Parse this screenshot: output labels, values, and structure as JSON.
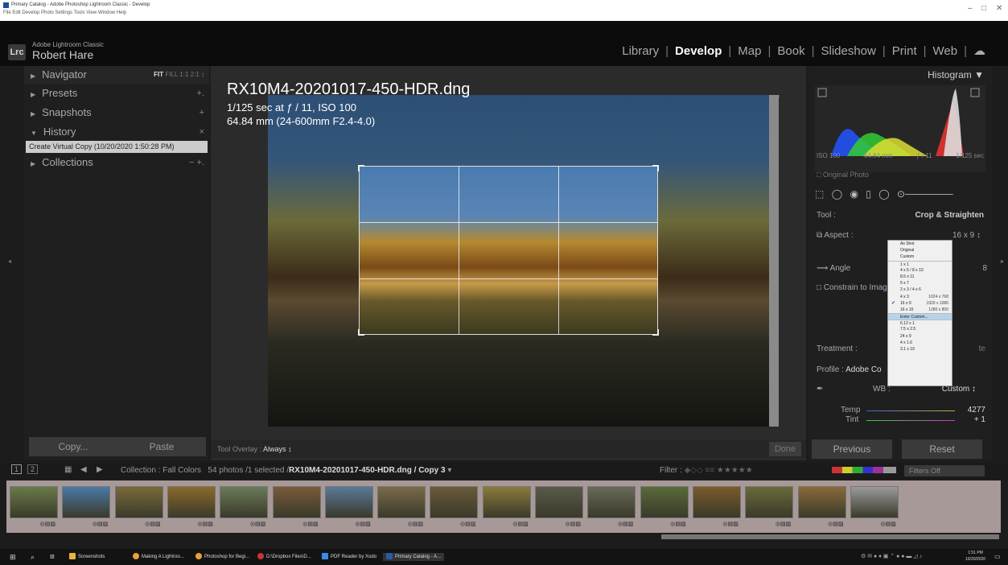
{
  "window": {
    "title": "Primary Catalog - Adobe Photoshop Lightroom Classic - Develop",
    "menu": "File  Edit  Develop  Photo  Settings  Tools  View  Window  Help",
    "controls": [
      "–",
      "□",
      "✕"
    ]
  },
  "brand": {
    "logo": "Lrc",
    "app": "Adobe Lightroom Classic",
    "user": "Robert Hare"
  },
  "modules": [
    "Library",
    "Develop",
    "Map",
    "Book",
    "Slideshow",
    "Print",
    "Web"
  ],
  "left_panel": {
    "navigator": "Navigator",
    "nav_zoom": {
      "fit": "FIT",
      "others": "FILL  1:1  2:1 ↕"
    },
    "presets": "Presets",
    "snapshots": "Snapshots",
    "history": "History",
    "history_item": "Create Virtual Copy (10/20/2020 1:50:28 PM)",
    "collections": "Collections",
    "copy": "Copy...",
    "paste": "Paste"
  },
  "photo": {
    "filename": "RX10M4-20201017-450-HDR.dng",
    "exposure": "1/125 sec at ƒ / 11, ISO 100",
    "lens": "64.84 mm (24-600mm F2.4-4.0)"
  },
  "toolbar": {
    "overlay_label": "Tool Overlay :",
    "overlay_value": "Always ↕",
    "done": "Done"
  },
  "right_panel": {
    "histogram": "Histogram ▼",
    "hist_info": [
      "ISO 100",
      "64.84 mm",
      "ƒ / 11",
      "1/125 sec"
    ],
    "original_photo": "□ Original Photo",
    "tool_label": "Tool :",
    "tool_value": "Crop & Straighten",
    "aspect_label": "Aspect :",
    "aspect_value": "16 x 9 ↕",
    "angle_label": "Angle",
    "angle_value": "8",
    "constrain": "□ Constrain to Image",
    "treatment": "Treatment :",
    "treatment_tail": "te",
    "profile_label": "Profile :",
    "profile_value": "Adobe Co",
    "wb_label": "WB :",
    "wb_value": "Custom ↕",
    "temp_label": "Temp",
    "temp_value": "4277",
    "tint_label": "Tint",
    "tint_value": "+ 1",
    "previous": "Previous",
    "reset": "Reset"
  },
  "aspect_menu": [
    {
      "label": "As Shot"
    },
    {
      "label": "Original"
    },
    {
      "label": "Custom"
    },
    {
      "label": "1 x 1",
      "sep": true
    },
    {
      "label": "4 x 5  /  8 x 10"
    },
    {
      "label": "8.5 x 11"
    },
    {
      "label": "5 x 7"
    },
    {
      "label": "2 x 3  /  4 x 6"
    },
    {
      "label": "4 x 3",
      "size": "1024 x 768"
    },
    {
      "label": "16 x 9",
      "size": "1920 x 1080",
      "checked": true
    },
    {
      "label": "16 x 10",
      "size": "1280 x 800"
    },
    {
      "label": "Enter Custom...",
      "sep": true,
      "highlight": true
    },
    {
      "label": "6.12 x 1",
      "sep": true
    },
    {
      "label": "7.5 x 2.5"
    },
    {
      "label": "24 x 9"
    },
    {
      "label": "4 x 1.6"
    },
    {
      "label": "3.1 x 19"
    }
  ],
  "filmstrip_bar": {
    "crumb_prefix": "Collection : Fall Colors",
    "crumb_count": "54 photos /1 selected /",
    "crumb_file": "RX10M4-20201017-450-HDR.dng / Copy 3",
    "crumb_suffix": " ▾",
    "filter_label": "Filter :",
    "stars": "★★★★★",
    "filters_off": "Filters Off"
  },
  "thumbnail_colors": [
    "#6a7a4a",
    "#4a7aa8",
    "#7a6a3a",
    "#8a6a2a",
    "#6a7a5a",
    "#7a5a3a",
    "#5a7a9a",
    "#7a6a4a",
    "#6a5a3a",
    "#8a7a3a",
    "#5a5a4a",
    "#6a6a5a",
    "#5a6a3a",
    "#7a5a2a",
    "#6a6a3a",
    "#8a6a3a",
    "#9a9a9a"
  ],
  "taskbar": [
    "Screenshots",
    "Making A Lightroo...",
    "Photoshop for Begi...",
    "D:\\Dropbox Files\\D...",
    "PDF Reader by Xodo",
    "Primary Catalog - A..."
  ],
  "clock": {
    "time": "1:51 PM",
    "date": "10/20/2020"
  }
}
